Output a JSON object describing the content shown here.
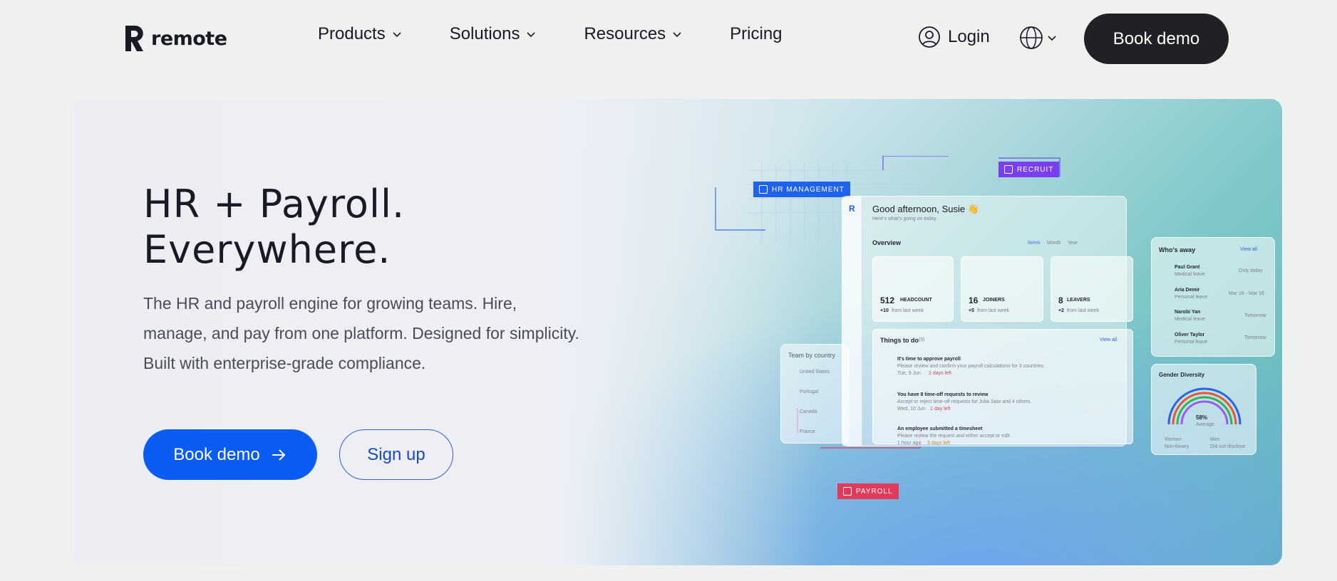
{
  "nav": {
    "logo_text": "remote",
    "items": [
      {
        "label": "Products"
      },
      {
        "label": "Solutions"
      },
      {
        "label": "Resources"
      },
      {
        "label": "Pricing"
      }
    ],
    "login_label": "Login",
    "book_demo_label": "Book demo"
  },
  "hero": {
    "title_line1": "HR + Payroll.",
    "title_line2": "Everywhere.",
    "description": "The HR and payroll engine for growing teams. Hire, manage, and pay from one platform. Designed for simplicity. Built with enterprise-grade compliance.",
    "cta_primary": "Book demo",
    "cta_secondary": "Sign up"
  },
  "colors": {
    "accent": "#0a5cf5",
    "dark": "#202124",
    "recruit": "#7b3ff2",
    "payroll": "#e23a5a"
  },
  "illustration": {
    "tags": {
      "hr": "HR MANAGEMENT",
      "recruit": "RECRUIT",
      "payroll": "PAYROLL"
    },
    "greeting": "Good afternoon, Susie 👋",
    "greeting_sub": "Here's what's going on today.",
    "overview": "Overview",
    "periods": [
      "Week",
      "Month",
      "Year"
    ],
    "stats": [
      {
        "value": "512",
        "label": "HEADCOUNT",
        "delta": "+10",
        "note": "from last week"
      },
      {
        "value": "16",
        "label": "JOINERS",
        "delta": "+5",
        "note": "from last week"
      },
      {
        "value": "8",
        "label": "LEAVERS",
        "delta": "+2",
        "note": "from last week"
      }
    ],
    "todo_title": "Things to do",
    "todo_count": "(5)",
    "view_all": "View all",
    "todos": [
      {
        "title": "It's time to approve payroll",
        "sub": "Please review and confirm your payroll calculations for 3 countries.",
        "date": "Tue, 9 Jun",
        "due": "2 days left"
      },
      {
        "title": "You have 8 time-off requests to review",
        "sub": "Accept or reject time-off requests for Julia Sato and 4 others.",
        "date": "Wed, 10 Jun",
        "due": "1 day left"
      },
      {
        "title": "An employee submitted a timesheet",
        "sub": "Please review the request and either accept or edit.",
        "date": "1 hour ago",
        "due": "3 days left"
      }
    ],
    "team_title": "Team by country",
    "countries": [
      "United States",
      "Portugal",
      "Canada",
      "France"
    ],
    "away_title": "Who's away",
    "away": [
      {
        "name": "Paul Grant",
        "type": "Medical leave",
        "when": "Only today"
      },
      {
        "name": "Aria Demir",
        "type": "Personal leave",
        "when": "Mar 16 - Mar 18"
      },
      {
        "name": "Narobi Yan",
        "type": "Medical leave",
        "when": "Tomorrow"
      },
      {
        "name": "Oliver Taylor",
        "type": "Personal leave",
        "when": "Tomorrow"
      }
    ],
    "diversity_title": "Gender Diversity",
    "diversity_value": "58%",
    "diversity_sub": "Average",
    "legend": [
      "Women",
      "Men",
      "Non-binary",
      "Did not disclose"
    ]
  }
}
